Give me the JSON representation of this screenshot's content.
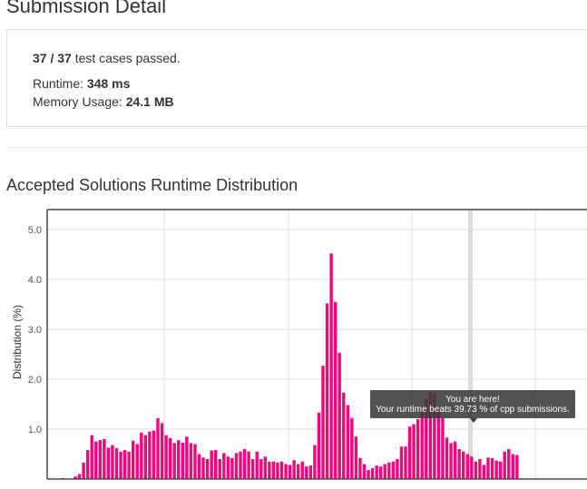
{
  "page": {
    "title": "Submission Detail"
  },
  "summary": {
    "tests_passed": "37 / 37",
    "tests_suffix": " test cases passed.",
    "runtime_label": "Runtime: ",
    "runtime_value": "348 ms",
    "memory_label": "Memory Usage: ",
    "memory_value": "24.1 MB"
  },
  "distribution": {
    "title": "Accepted Solutions Runtime Distribution",
    "tooltip_title": "You are here!",
    "tooltip_text": "Your runtime beats 39.73 % of cpp submissions.",
    "colors": {
      "bar": "#f0077b",
      "highlight_band": "#dddddd",
      "tooltip_bg": "#3a3a3a",
      "grid": "#e0e0e0"
    }
  },
  "chart_data": {
    "type": "bar",
    "ylabel": "Distribution (%)",
    "xlabel": "",
    "ylim": [
      0,
      5.4
    ],
    "yticks": [
      "5.0",
      "4.0",
      "3.0",
      "2.0",
      "1.0"
    ],
    "ytick_values": [
      5,
      4,
      3,
      2,
      1
    ],
    "x_start": 4,
    "x_step": 4,
    "you_are_here_x": 348,
    "values": [
      0.0,
      0.0,
      0.0,
      0.02,
      0.0,
      0.0,
      0.05,
      0.1,
      0.33,
      0.58,
      0.88,
      0.75,
      0.78,
      0.8,
      0.63,
      0.68,
      0.62,
      0.55,
      0.58,
      0.55,
      0.77,
      0.7,
      0.93,
      0.88,
      0.95,
      0.97,
      1.22,
      1.12,
      0.88,
      0.82,
      0.72,
      0.78,
      0.73,
      0.85,
      0.72,
      0.7,
      0.5,
      0.43,
      0.4,
      0.57,
      0.58,
      0.4,
      0.52,
      0.45,
      0.42,
      0.52,
      0.55,
      0.6,
      0.55,
      0.4,
      0.55,
      0.4,
      0.45,
      0.35,
      0.35,
      0.33,
      0.35,
      0.3,
      0.28,
      0.38,
      0.3,
      0.35,
      0.25,
      0.27,
      0.68,
      1.33,
      2.27,
      3.52,
      4.52,
      3.55,
      2.53,
      1.73,
      1.48,
      1.22,
      0.85,
      0.42,
      0.3,
      0.18,
      0.22,
      0.27,
      0.25,
      0.3,
      0.33,
      0.35,
      0.4,
      0.65,
      0.65,
      1.05,
      1.1,
      1.2,
      1.4,
      1.6,
      1.75,
      1.72,
      1.45,
      1.22,
      0.83,
      0.72,
      0.75,
      0.6,
      0.55,
      0.5,
      0.45,
      0.35,
      0.4,
      0.28,
      0.43,
      0.42,
      0.37,
      0.35,
      0.55,
      0.6,
      0.5,
      0.48
    ]
  }
}
